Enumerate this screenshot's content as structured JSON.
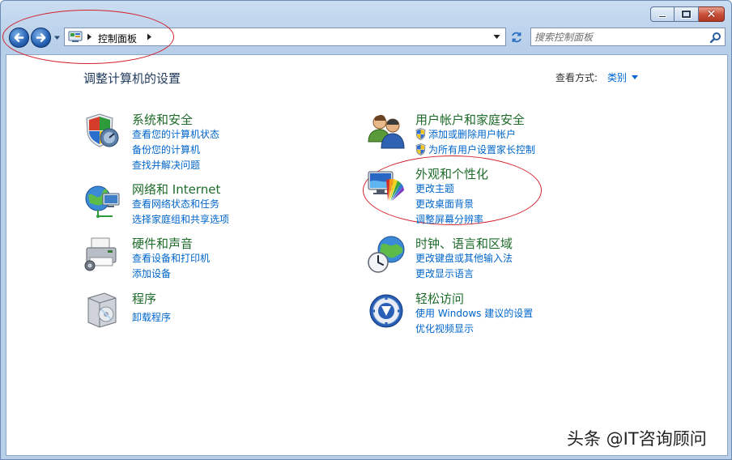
{
  "window": {
    "caption": {
      "minimize": "minimize",
      "maximize": "maximize",
      "close": "close"
    }
  },
  "nav": {
    "address": {
      "crumb": "控制面板"
    },
    "search": {
      "placeholder": "搜索控制面板"
    }
  },
  "header": {
    "title": "调整计算机的设置",
    "view_by_label": "查看方式:",
    "view_by_value": "类别"
  },
  "categories": [
    {
      "title": "系统和安全",
      "links": [
        "查看您的计算机状态",
        "备份您的计算机",
        "查找并解决问题"
      ]
    },
    {
      "title": "网络和 Internet",
      "links": [
        "查看网络状态和任务",
        "选择家庭组和共享选项"
      ]
    },
    {
      "title": "硬件和声音",
      "links": [
        "查看设备和打印机",
        "添加设备"
      ]
    },
    {
      "title": "程序",
      "links": [
        "卸载程序"
      ]
    },
    {
      "title": "用户帐户和家庭安全",
      "links": [
        "添加或删除用户帐户",
        "为所有用户设置家长控制"
      ]
    },
    {
      "title": "外观和个性化",
      "links": [
        "更改主题",
        "更改桌面背景",
        "调整屏幕分辨率"
      ]
    },
    {
      "title": "时钟、语言和区域",
      "links": [
        "更改键盘或其他输入法",
        "更改显示语言"
      ]
    },
    {
      "title": "轻松访问",
      "links": [
        "使用 Windows 建议的设置",
        "优化视频显示"
      ]
    }
  ],
  "watermark": "头条 @IT咨询顾问",
  "colors": {
    "link": "#0066cc",
    "category_title": "#1e6b2a",
    "annotation": "#d2202a"
  }
}
